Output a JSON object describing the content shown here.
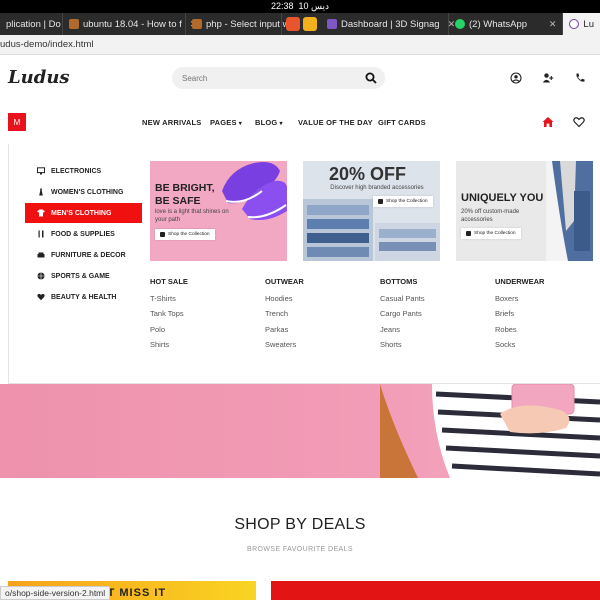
{
  "system": {
    "time": "22:38",
    "date": "10 ديس"
  },
  "browser": {
    "tabs": [
      {
        "label": "plication | Do",
        "active": false
      },
      {
        "label": "ubuntu 18.04 - How to f",
        "active": false
      },
      {
        "label": "php - Select input w",
        "active": false
      },
      {
        "label": "Dashboard | 3D Signag",
        "active": false
      },
      {
        "label": "(2) WhatsApp",
        "active": false
      },
      {
        "label": "Lu",
        "active": true
      }
    ],
    "url": "udus-demo/index.html",
    "status_url": "o/shop-side-version-2.html"
  },
  "header": {
    "logo": "Ludus",
    "search_placeholder": "Search"
  },
  "nav": {
    "menu_button": "M",
    "items": [
      {
        "label": "NEW ARRIVALS"
      },
      {
        "label": "PAGES"
      },
      {
        "label": "BLOG"
      },
      {
        "label": "VALUE OF THE DAY"
      },
      {
        "label": "GIFT CARDS"
      }
    ]
  },
  "categories": [
    {
      "label": "ELECTRONICS",
      "icon": "monitor-icon"
    },
    {
      "label": "WOMEN'S CLOTHING",
      "icon": "dress-icon"
    },
    {
      "label": "MEN'S CLOTHING",
      "icon": "shirt-icon",
      "active": true
    },
    {
      "label": "FOOD & SUPPLIES",
      "icon": "cutlery-icon"
    },
    {
      "label": "FURNITURE & DECOR",
      "icon": "sofa-icon"
    },
    {
      "label": "SPORTS & GAME",
      "icon": "ball-icon"
    },
    {
      "label": "BEAUTY & HEALTH",
      "icon": "heart-icon"
    }
  ],
  "banners": [
    {
      "title": "BE BRIGHT, BE SAFE",
      "title_line1": "BE BRIGHT,",
      "title_line2": "BE SAFE",
      "subtitle": "love is a light that shines on your path",
      "button": "Shop the Collection"
    },
    {
      "title": "20% OFF",
      "subtitle": "Discover high branded accessories",
      "button": "Shop the Collection"
    },
    {
      "title": "UNIQUELY YOU",
      "subtitle": "20% off custom-made accessories",
      "button": "Shop the Collection"
    }
  ],
  "columns": [
    {
      "heading": "HOT SALE",
      "links": [
        "T-Shirts",
        "Tank Tops",
        "Polo",
        "Shirts"
      ]
    },
    {
      "heading": "OUTWEAR",
      "links": [
        "Hoodies",
        "Trench",
        "Parkas",
        "Sweaters"
      ]
    },
    {
      "heading": "BOTTOMS",
      "links": [
        "Casual Pants",
        "Cargo Pants",
        "Jeans",
        "Shorts"
      ]
    },
    {
      "heading": "UNDERWEAR",
      "links": [
        "Boxers",
        "Briefs",
        "Robes",
        "Socks"
      ]
    }
  ],
  "deals": {
    "title": "SHOP BY DEALS",
    "subtitle": "BROWSE FAVOURITE DEALS",
    "card1_text": "'T MISS IT"
  },
  "colors": {
    "accent": "#e8121c",
    "hero_pink": "#f29bb6",
    "deal_yellow": "#f9d422"
  }
}
